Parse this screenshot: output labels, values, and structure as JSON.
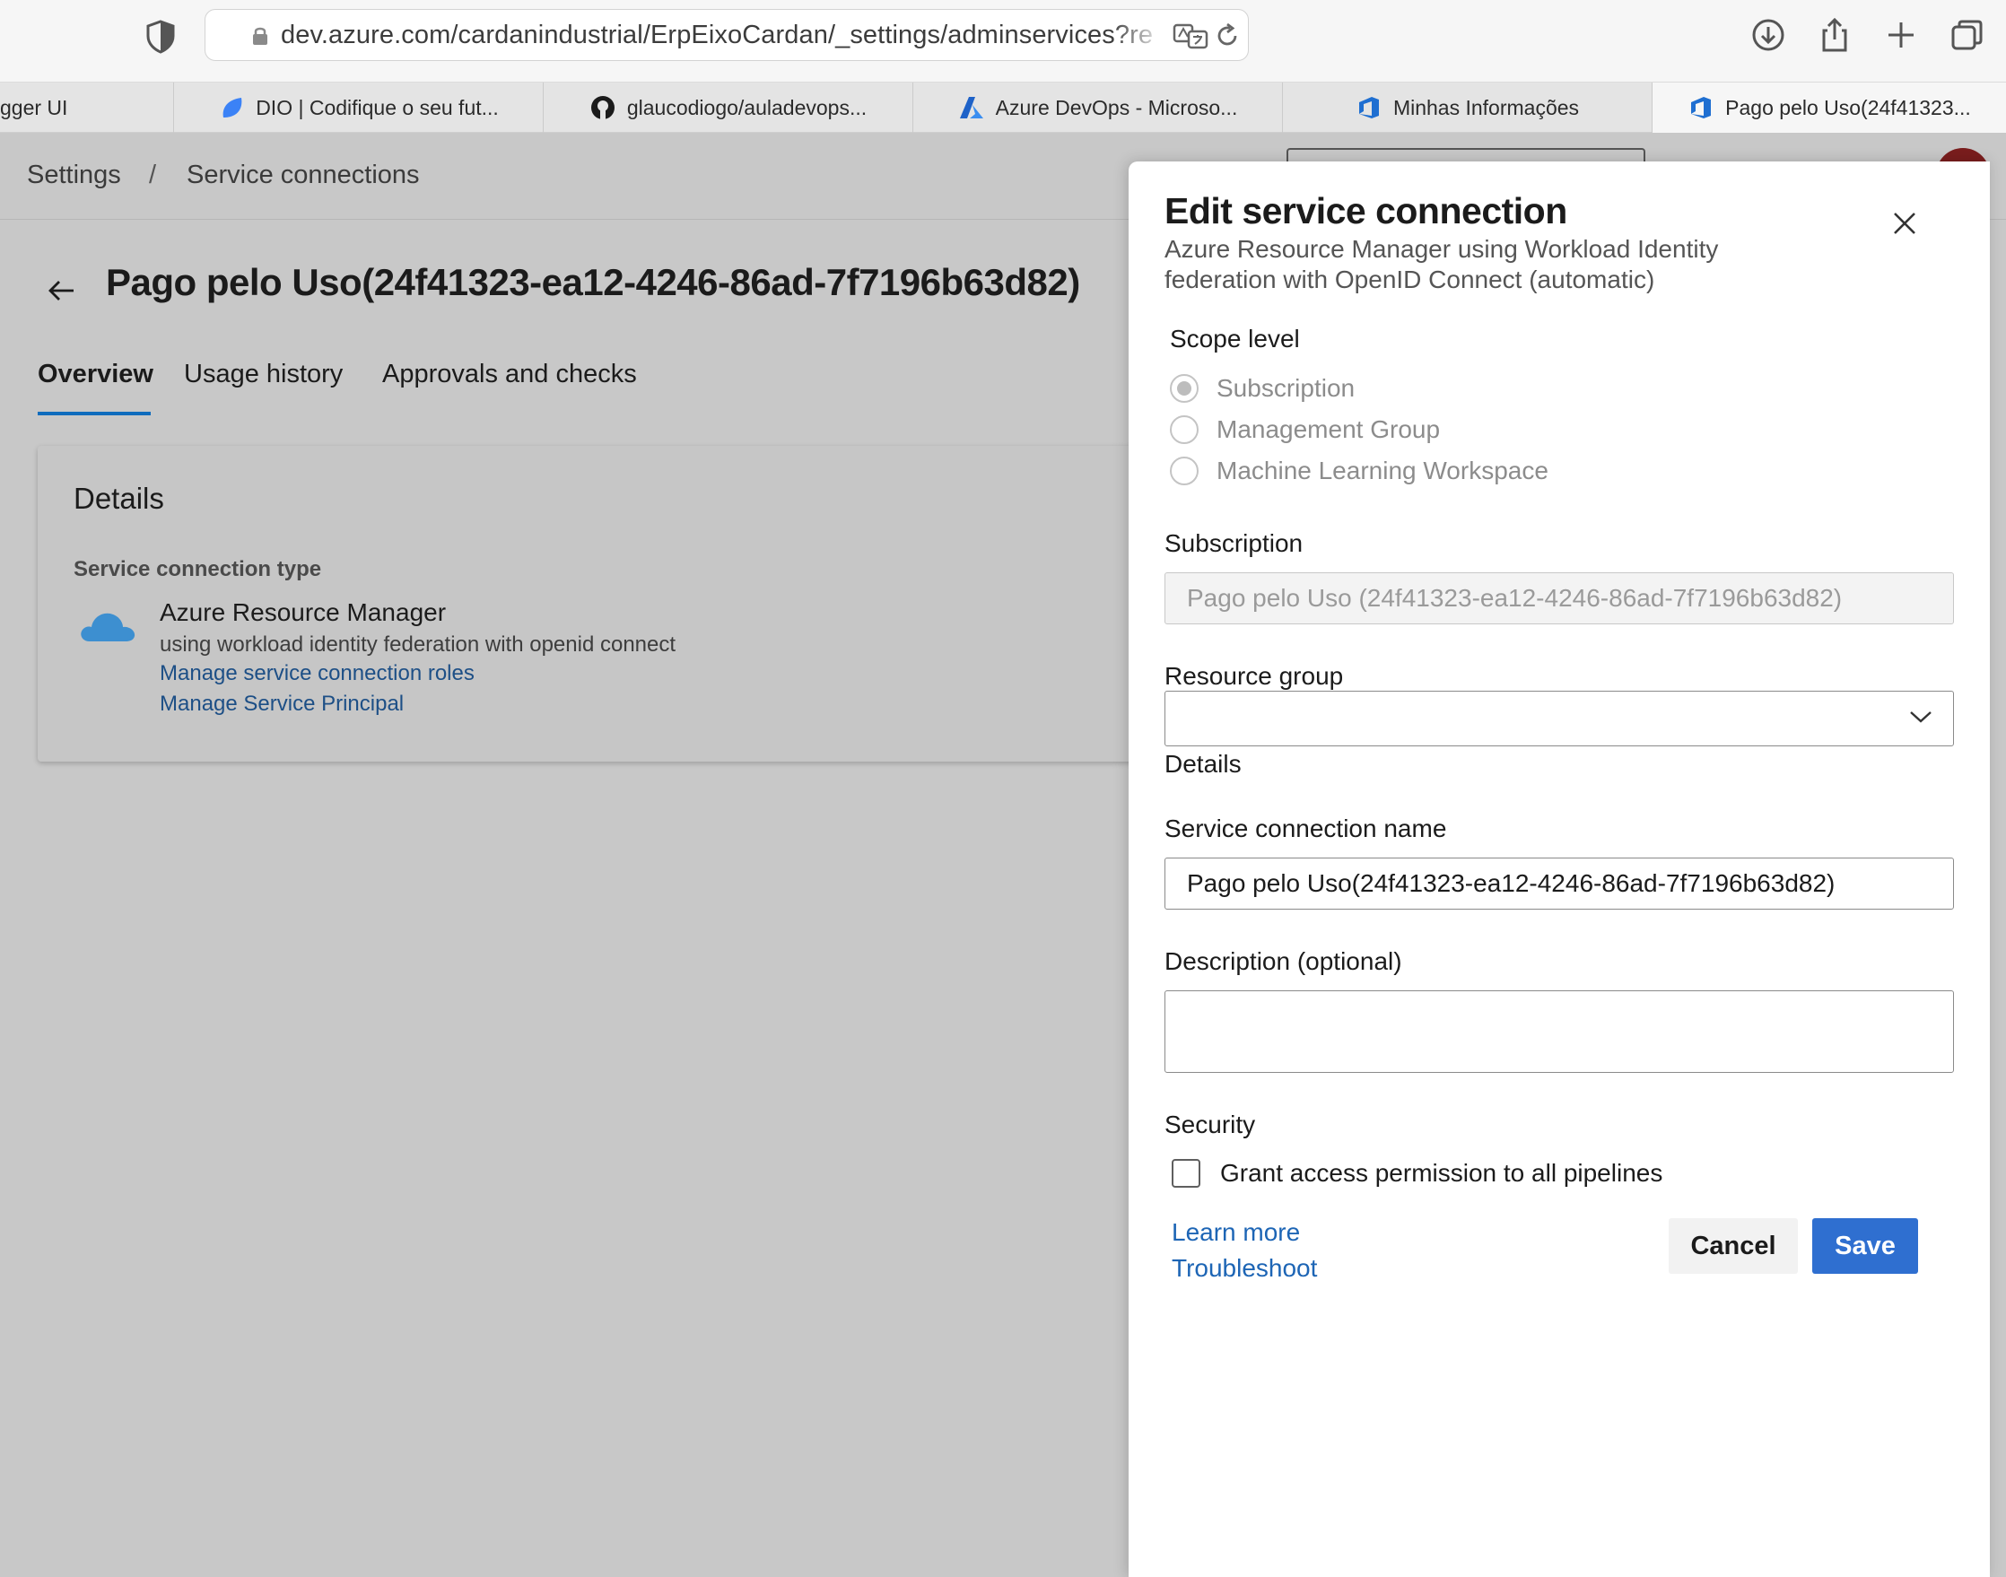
{
  "browser": {
    "url": "dev.azure.com/cardanindustrial/ErpEixoCardan/_settings/adminservices?resourc",
    "tabs": [
      {
        "title": "gger UI",
        "icon": "none"
      },
      {
        "title": "DIO | Codifique o seu fut...",
        "icon": "dio-icon"
      },
      {
        "title": "glaucodiogo/auladevops...",
        "icon": "github-icon"
      },
      {
        "title": "Azure DevOps - Microso...",
        "icon": "azure-icon"
      },
      {
        "title": "Minhas Informações",
        "icon": "devops-icon"
      },
      {
        "title": "Pago pelo Uso(24f41323...",
        "icon": "devops-icon",
        "active": true
      }
    ]
  },
  "breadcrumb": {
    "root": "Settings",
    "separator": "/",
    "current": "Service connections"
  },
  "page": {
    "title": "Pago pelo Uso(24f41323-ea12-4246-86ad-7f7196b63d82)",
    "tabs": [
      "Overview",
      "Usage history",
      "Approvals and checks"
    ],
    "active_tab": "Overview"
  },
  "details": {
    "title": "Details",
    "type_label": "Service connection type",
    "type_name": "Azure Resource Manager",
    "type_desc": "using workload identity federation with openid connect",
    "links": [
      "Manage service connection roles",
      "Manage Service Principal"
    ]
  },
  "panel": {
    "title": "Edit service connection",
    "subtitle_line1": "Azure Resource Manager using Workload Identity",
    "subtitle_line2": "federation with OpenID Connect (automatic)",
    "scope_label": "Scope level",
    "scope_options": [
      "Subscription",
      "Management Group",
      "Machine Learning Workspace"
    ],
    "scope_selected": "Subscription",
    "subscription_label": "Subscription",
    "subscription_value": "Pago pelo Uso (24f41323-ea12-4246-86ad-7f7196b63d82)",
    "resource_group_label": "Resource group",
    "resource_group_value": "",
    "details_label": "Details",
    "name_label": "Service connection name",
    "name_value": "Pago pelo Uso(24f41323-ea12-4246-86ad-7f7196b63d82)",
    "description_label": "Description (optional)",
    "description_value": "",
    "security_label": "Security",
    "grant_access_label": "Grant access permission to all pipelines",
    "grant_access_checked": false,
    "learn_more": "Learn more",
    "troubleshoot": "Troubleshoot",
    "cancel_label": "Cancel",
    "save_label": "Save"
  },
  "colors": {
    "accent": "#2f6fd0",
    "link": "#1d65b5",
    "overlay": "#c8c8c8"
  }
}
